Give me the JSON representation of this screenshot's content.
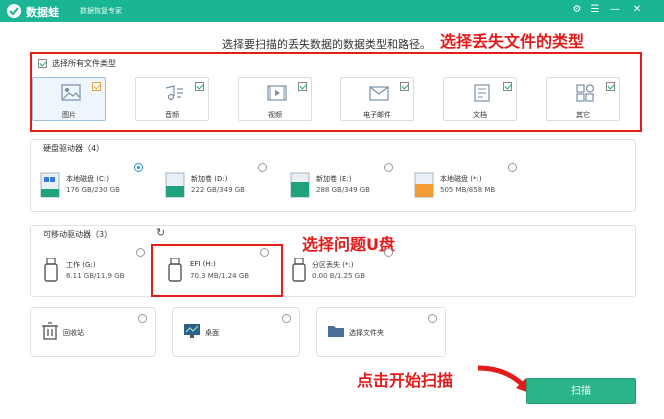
{
  "app": {
    "name": "数据蛙",
    "subtitle": "数据恢复专家",
    "accent": "#19b595"
  },
  "instruction": "选择要扫描的丢失数据的数据类型和路径。",
  "annotations": {
    "types": "选择丢失文件的类型",
    "problem_drive": "选择问题U盘",
    "start_scan": "点击开始扫描"
  },
  "file_types": {
    "select_all_label": "选择所有文件类型",
    "items": [
      {
        "label": "图片",
        "icon": "image-icon",
        "checked": true
      },
      {
        "label": "音频",
        "icon": "audio-icon",
        "checked": true
      },
      {
        "label": "视频",
        "icon": "video-icon",
        "checked": true
      },
      {
        "label": "电子邮件",
        "icon": "email-icon",
        "checked": true
      },
      {
        "label": "文档",
        "icon": "document-icon",
        "checked": true
      },
      {
        "label": "其它",
        "icon": "other-icon",
        "checked": true
      }
    ]
  },
  "hard_drives": {
    "title": "硬盘驱动器（4）",
    "items": [
      {
        "name": "本地磁盘 (C:)",
        "size": "176 GB/230 GB",
        "selected": true
      },
      {
        "name": "新加卷 (D:)",
        "size": "222 GB/349 GB",
        "selected": false
      },
      {
        "name": "新加卷 (E:)",
        "size": "288 GB/349 GB",
        "selected": false
      },
      {
        "name": "本地磁盘 (*:)",
        "size": "505 MB/858 MB",
        "selected": false
      }
    ]
  },
  "removable_drives": {
    "title": "可移动驱动器（3）",
    "items": [
      {
        "name": "工作 (G:)",
        "size": "6.11 GB/11.9 GB"
      },
      {
        "name": "EFI (H:)",
        "size": "70.3 MB/1.24 GB"
      },
      {
        "name": "分区丢失 (*:)",
        "size": "0.00 B/1.25 GB"
      }
    ]
  },
  "locations": [
    {
      "label": "回收站",
      "icon": "recycle-bin-icon"
    },
    {
      "label": "桌面",
      "icon": "desktop-icon"
    },
    {
      "label": "选择文件夹",
      "icon": "folder-icon"
    }
  ],
  "scan_button": "扫描"
}
